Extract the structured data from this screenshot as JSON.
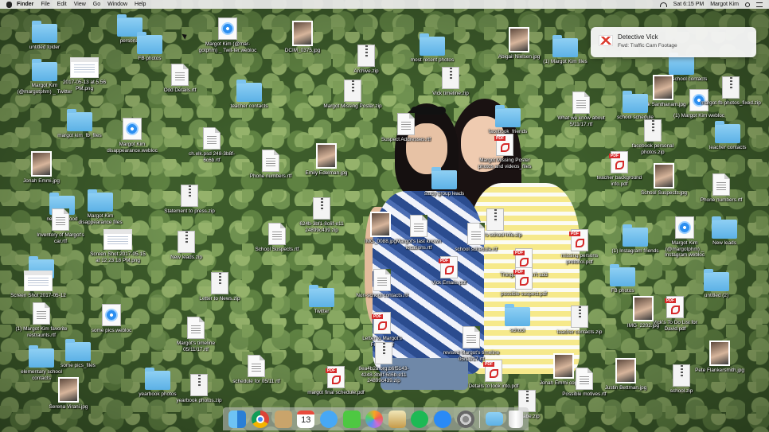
{
  "menubar": {
    "menus": [
      "Finder",
      "File",
      "Edit",
      "View",
      "Go",
      "Window",
      "Help"
    ],
    "clock": "Sat 6:15 PM",
    "user": "Margot Kim"
  },
  "notification": {
    "app_icon": "gmail-icon",
    "title": "Detective Vick",
    "subtitle": "Fwd: Traffic Cam Footage"
  },
  "desktop_icons": [
    {
      "label": "untitled folder",
      "type": "folder"
    },
    {
      "label": "personal",
      "type": "folder"
    },
    {
      "label": "FB photos",
      "type": "folder"
    },
    {
      "label": "Margot Kim (@mar-gotphm) _ Twit-ter.webloc",
      "type": "web"
    },
    {
      "label": "DCIM_0375.jpg",
      "type": "img"
    },
    {
      "label": "Archive.zip",
      "type": "zip"
    },
    {
      "label": "most recent photos",
      "type": "folder"
    },
    {
      "label": "Abigail Nielsen.jpg",
      "type": "img"
    },
    {
      "label": "(1) Margot Kim files",
      "type": "folder"
    },
    {
      "label": "middle school contacts",
      "type": "folder"
    },
    {
      "label": "Margot Kim (@margotphm) _ Twitter",
      "type": "folder"
    },
    {
      "label": "2017-05-13 at 5.56 PM.png",
      "type": "shot"
    },
    {
      "label": "Odd Details.rtf",
      "type": "doc"
    },
    {
      "label": "teacher contacts",
      "type": "folder"
    },
    {
      "label": "Margot Missing Poster.zip",
      "type": "zip"
    },
    {
      "label": "Vick timeline.zip",
      "type": "zip"
    },
    {
      "label": "What we know about 5/11/17.rtf",
      "type": "doc"
    },
    {
      "label": "Nick Santhanam.jpg",
      "type": "img"
    },
    {
      "label": "school schedule",
      "type": "folder"
    },
    {
      "label": "(1) Margot Kim webloc",
      "type": "web"
    },
    {
      "label": "margot-fb-photos_fixed.zip",
      "type": "zip"
    },
    {
      "label": "margot kim_fb_files",
      "type": "folder"
    },
    {
      "label": "Margot Kim disappearance.webloc",
      "type": "web"
    },
    {
      "label": "ch.elk.psd 248-3b8f-6c6b.rtf",
      "type": "doc"
    },
    {
      "label": "Suspect Addresses.rtf",
      "type": "doc"
    },
    {
      "label": "facebook_friends",
      "type": "folder"
    },
    {
      "label": "Margot Missing Poster photos and videos_files",
      "type": "pdf"
    },
    {
      "label": "facebook personal photos.zip",
      "type": "zip"
    },
    {
      "label": "teacher contacts",
      "type": "folder"
    },
    {
      "label": "Jonah Emmi.jpg",
      "type": "img"
    },
    {
      "label": "Phone numbers.rtf",
      "type": "doc"
    },
    {
      "label": "Emily Edelman.jpg",
      "type": "img"
    },
    {
      "label": "study group leads",
      "type": "folder"
    },
    {
      "label": "teacher background info.pdf",
      "type": "pdf"
    },
    {
      "label": "School Suspects.jpg",
      "type": "img"
    },
    {
      "label": "Phone numbers.rtf",
      "type": "doc"
    },
    {
      "label": "neighborhood",
      "type": "folder"
    },
    {
      "label": "Margot Kim disappearance files",
      "type": "folder"
    },
    {
      "label": "Statement to press.zip",
      "type": "zip"
    },
    {
      "label": "624b-3bf1-8c6f-e11 24899c439.zip",
      "type": "zip"
    },
    {
      "label": "Margot's school info.zip",
      "type": "zip"
    },
    {
      "label": "Inventory of Margot's car.rtf",
      "type": "doc"
    },
    {
      "label": "Screen Shot 2017-05-15 at 12.23.18 PM.png",
      "type": "shot"
    },
    {
      "label": "New leads.zip",
      "type": "zip"
    },
    {
      "label": "School Suspects.rtf",
      "type": "doc"
    },
    {
      "label": "IMG_0088.jpg",
      "type": "img"
    },
    {
      "label": "Margot's last known locations.rtf",
      "type": "doc"
    },
    {
      "label": "school schedule.rtf",
      "type": "doc"
    },
    {
      "label": "missing persons protocol.pdf",
      "type": "pdf"
    },
    {
      "label": "(1) Instagram friends",
      "type": "folder"
    },
    {
      "label": "Margot Kim (@margotphm) _ Instagram.webloc",
      "type": "web"
    },
    {
      "label": "New leads",
      "type": "folder"
    },
    {
      "label": "Twitter",
      "type": "folder"
    },
    {
      "label": "Vick Emails.pdf",
      "type": "pdf"
    },
    {
      "label": "Things that don't add up.pdf",
      "type": "pdf"
    },
    {
      "label": "possible suspect.pdf",
      "type": "pdf"
    },
    {
      "label": "Screen Shot 2017-05-12",
      "type": "shot"
    },
    {
      "label": "Letter to News.zip",
      "type": "zip"
    },
    {
      "label": "Non-school contacts.rtf",
      "type": "doc"
    },
    {
      "label": "FB photos",
      "type": "folder"
    },
    {
      "label": "untitled (2)",
      "type": "folder"
    },
    {
      "label": "(1) Margot Kim favorite restraunts.rtf",
      "type": "doc"
    },
    {
      "label": "Twitter",
      "type": "folder"
    },
    {
      "label": "Letter to Margot's Friend.pdf",
      "type": "pdf"
    },
    {
      "label": "school",
      "type": "folder"
    },
    {
      "label": "Vick's To Do List for David.pdf",
      "type": "pdf"
    },
    {
      "label": "some pics.webloc",
      "type": "web"
    },
    {
      "label": "Margot's timeline 05/11/17.rtf",
      "type": "doc"
    },
    {
      "label": "teacher contacts.zip",
      "type": "zip"
    },
    {
      "label": "IMG_2202.jpg",
      "type": "img"
    },
    {
      "label": "elementary school contacts",
      "type": "folder"
    },
    {
      "label": "some pics_files",
      "type": "folder"
    },
    {
      "label": "schedule for 05/11.rtf",
      "type": "doc"
    },
    {
      "label": "revised Margot's timeline 05/13/17.rtf",
      "type": "doc"
    },
    {
      "label": "Jonah Emmi copy.jpg",
      "type": "img"
    },
    {
      "label": "Pete Flankersmith.jpg",
      "type": "img"
    },
    {
      "label": "yearbook photos",
      "type": "folder"
    },
    {
      "label": "8ea4b2a.org.b6f5143-4248-3b8f-6c6b-e11 24899c439.zip",
      "type": "zip"
    },
    {
      "label": "Details to look into.pdf",
      "type": "pdf"
    },
    {
      "label": "Justin Bettman.jpg",
      "type": "img"
    },
    {
      "label": "school.zip",
      "type": "zip"
    },
    {
      "label": "Serena Virani.jpg",
      "type": "img"
    },
    {
      "label": "yearbook photos.zip",
      "type": "zip"
    },
    {
      "label": "margot final schedule.pdf",
      "type": "pdf"
    },
    {
      "label": "Possible motives.rtf",
      "type": "doc"
    },
    {
      "label": "hohabe.zip",
      "type": "zip"
    }
  ],
  "dock": [
    {
      "name": "finder-icon",
      "cls": "finder"
    },
    {
      "name": "chrome-icon",
      "cls": "chrome"
    },
    {
      "name": "contacts-icon",
      "cls": "contacts"
    },
    {
      "name": "calendar-icon",
      "cls": "calendar",
      "text": "13"
    },
    {
      "name": "messages-icon",
      "cls": "messages"
    },
    {
      "name": "wechat-icon",
      "cls": "wechat"
    },
    {
      "name": "photos-icon",
      "cls": "photos"
    },
    {
      "name": "preview-icon",
      "cls": "preview"
    },
    {
      "name": "spotify-icon",
      "cls": "spotify"
    },
    {
      "name": "app-store-icon",
      "cls": "appstore"
    },
    {
      "name": "system-preferences-icon",
      "cls": "prefs"
    },
    {
      "name": "separator",
      "cls": "sep"
    },
    {
      "name": "downloads-folder-icon",
      "cls": "folder"
    },
    {
      "name": "trash-icon",
      "cls": "trash"
    }
  ]
}
